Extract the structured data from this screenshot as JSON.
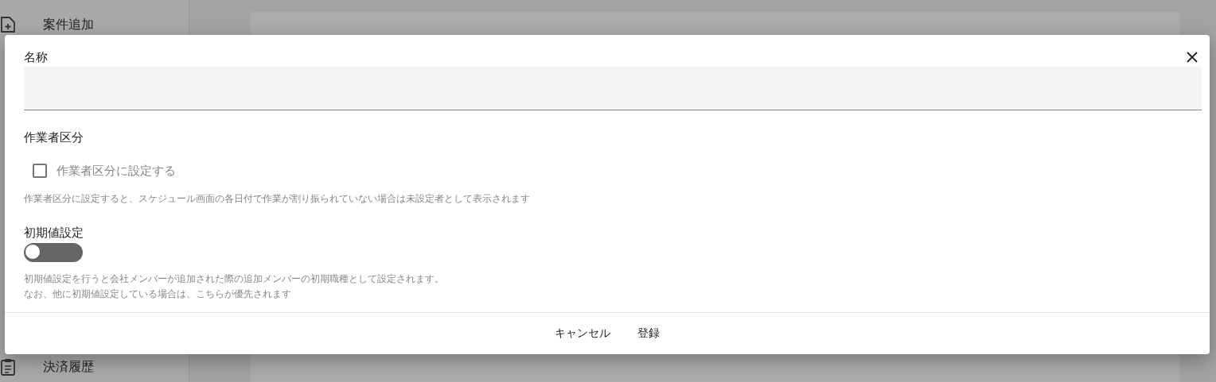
{
  "sidebar": {
    "items": [
      {
        "label": "案件追加"
      },
      {
        "label": "決済履歴"
      }
    ]
  },
  "dialog": {
    "name_field": {
      "label": "名称"
    },
    "worker_type": {
      "label": "作業者区分",
      "checkbox": {
        "label": "作業者区分に設定する",
        "checked": false
      },
      "hint": "作業者区分に設定すると、スケジュール画面の各日付で作業が割り振られていない場合は未設定者として表示されます"
    },
    "default_setting": {
      "label": "初期値設定",
      "toggle": {
        "on": false
      },
      "hint_lines": [
        "初期値設定を行うと会社メンバーが追加された際の追加メンバーの初期職種として設定されます。",
        "なお、他に初期値設定している場合は、こちらが優先されます"
      ]
    },
    "buttons": [
      "キャンセル",
      "登録"
    ]
  }
}
